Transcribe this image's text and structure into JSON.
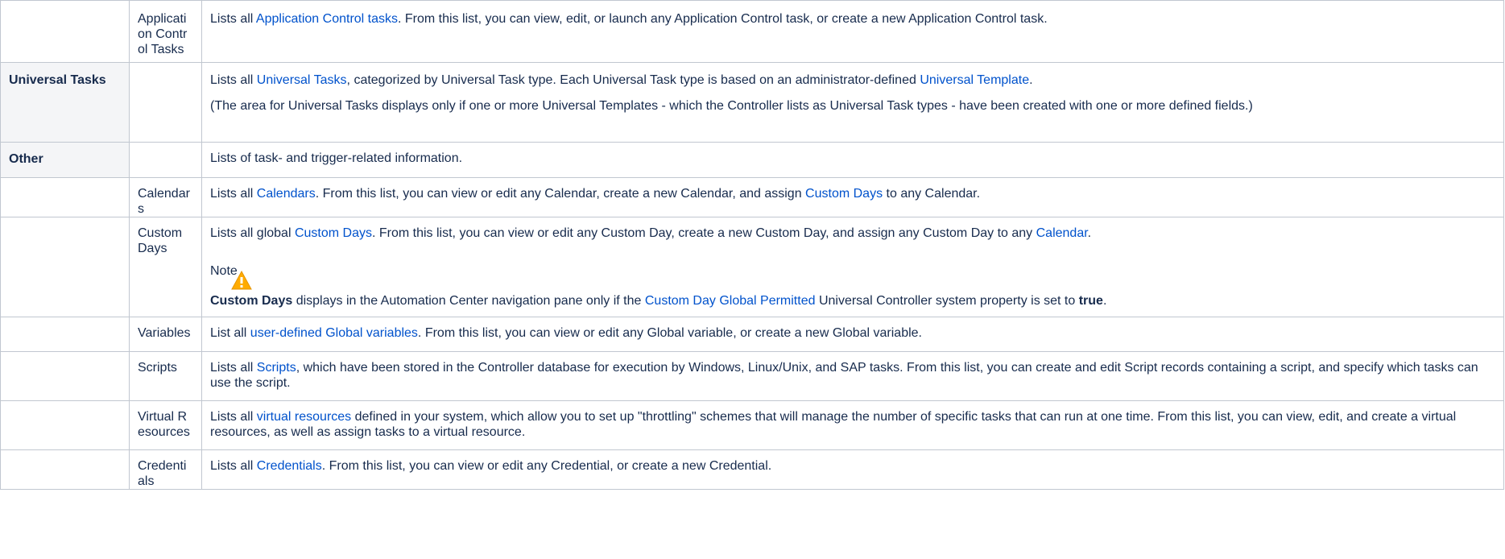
{
  "rows": {
    "app_control": {
      "name": "Application Control Tasks",
      "pre": "Lists all ",
      "link": "Application Control tasks",
      "post": ". From this list, you can view, edit, or launch any Application Control task, or create a new Application Control task."
    },
    "universal": {
      "category": "Universal Tasks",
      "p1_pre": "Lists all ",
      "p1_link1": "Universal Tasks",
      "p1_mid": ", categorized by Universal Task type. Each Universal Task type is based on an administrator-defined ",
      "p1_link2": "Universal Template",
      "p1_post": ".",
      "p2": "(The area for Universal Tasks displays only if one or more Universal Templates - which the Controller lists as Universal Task types - have been created with one or more defined fields.)"
    },
    "other": {
      "category": "Other",
      "desc": "Lists of task- and trigger-related information."
    },
    "calendars": {
      "name": "Calendars",
      "pre": "Lists all ",
      "link1": "Calendars",
      "mid": ". From this list, you can view or edit any Calendar, create a new Calendar, and assign ",
      "link2": "Custom Days",
      "post": " to any Calendar."
    },
    "custom_days": {
      "name": "Custom Days",
      "pre": "Lists all global ",
      "link1": "Custom Days",
      "mid": ". From this list, you can view or edit any Custom Day, create a new Custom Day, and assign any Custom Day to any ",
      "link2": "Calendar",
      "post": ".",
      "note_title": "Note",
      "note_bold": "Custom Days",
      "note_mid": " displays in the Automation Center navigation pane only if the ",
      "note_link": "Custom Day Global Permitted",
      "note_post": " Universal Controller system property is set to ",
      "note_value": "true",
      "note_end": "."
    },
    "variables": {
      "name": "Variables",
      "pre": "List all ",
      "link": "user-defined Global variables",
      "post": ". From this list, you can view or edit any Global variable, or create a new Global variable."
    },
    "scripts": {
      "name": "Scripts",
      "pre": "Lists all ",
      "link": "Scripts",
      "post": ", which have been stored in the Controller database for execution by Windows, Linux/Unix, and SAP tasks. From this list, you can create and edit Script records containing a script, and specify which tasks can use the script."
    },
    "virtual_resources": {
      "name": "Virtual Resources",
      "pre": "Lists all ",
      "link": "virtual resources",
      "post": " defined in your system, which allow you to set up \"throttling\" schemes that will manage the number of specific tasks that can run at one time. From this list, you can view, edit, and create a virtual resources, as well as assign tasks to a virtual resource."
    },
    "credentials": {
      "name": "Credentials",
      "pre": "Lists all ",
      "link": "Credentials",
      "post": ". From this list, you can view or edit any Credential, or create a new Credential."
    }
  },
  "icons": {
    "note_icon": "warning-triangle-icon",
    "note_icon_color": "#ffab00"
  },
  "colors": {
    "link": "#0052cc",
    "text": "#172b4d",
    "border": "#c1c7d0",
    "header_bg": "#f4f5f7"
  }
}
